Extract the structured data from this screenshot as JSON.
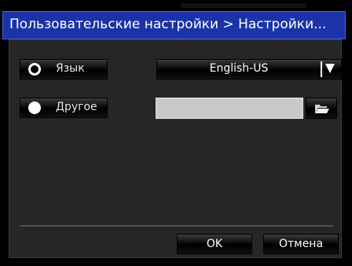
{
  "dialog": {
    "title": "Пользовательские настройки > Настройки..."
  },
  "options": [
    {
      "label": "Язык",
      "radio": "unselected",
      "control": "dropdown",
      "value": "English-US"
    },
    {
      "label": "Другое",
      "radio": "selected",
      "control": "path-input",
      "value": ""
    }
  ],
  "footer": {
    "ok_label": "OK",
    "cancel_label": "Отмена"
  },
  "colors": {
    "title_bar": "#1a33a8",
    "panel": "#262626",
    "input_bg": "#c9c9c9"
  }
}
